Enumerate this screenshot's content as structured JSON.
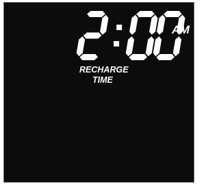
{
  "display": {
    "time_text": "2:00",
    "digits": [
      "2",
      "0",
      "0"
    ],
    "ampm": "AM",
    "label_line1": "RECHARGE",
    "label_line2": "TIME"
  },
  "colors": {
    "lcd_background": "#0c0c0c",
    "segment_on": "#ffffff",
    "frame_border": "#6a6a6a",
    "page_background": "#ffffff"
  }
}
